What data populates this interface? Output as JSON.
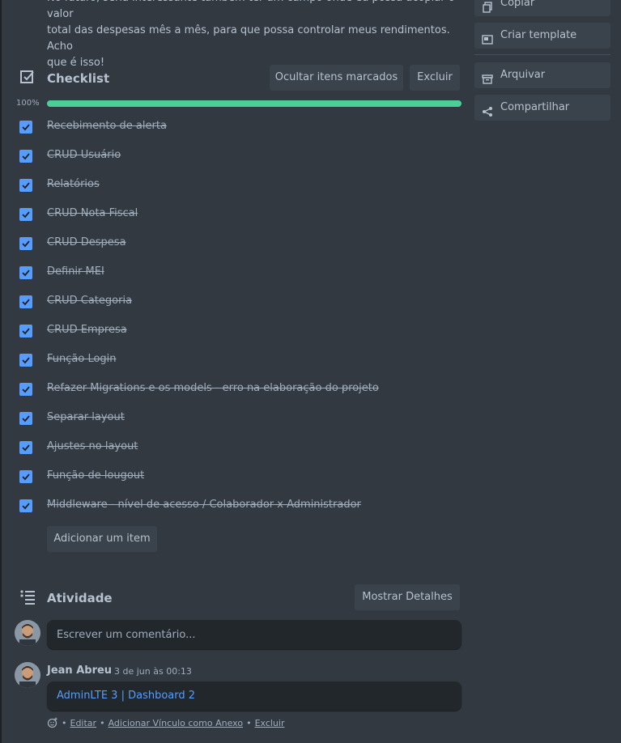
{
  "description": {
    "line1": "No futuro, seria interessante também ter um campo onde eu possa acoplar o valor",
    "line2": "total das despesas mês a mês, para que possa controlar meus rendimentos. Acho",
    "line3": "que é isso!"
  },
  "checklist": {
    "title": "Checklist",
    "hide_checked_label": "Ocultar itens marcados",
    "delete_label": "Excluir",
    "progress_label": "100%",
    "progress": 1.0,
    "items": [
      {
        "label": "Recebimento de alerta",
        "checked": true
      },
      {
        "label": "CRUD Usuário",
        "checked": true
      },
      {
        "label": "Relatórios",
        "checked": true
      },
      {
        "label": "CRUD Nota Fiscal",
        "checked": true
      },
      {
        "label": "CRUD Despesa",
        "checked": true
      },
      {
        "label": "Definir MEI",
        "checked": true
      },
      {
        "label": "CRUD Categoria",
        "checked": true
      },
      {
        "label": "CRUD Empresa",
        "checked": true
      },
      {
        "label": "Função Login",
        "checked": true
      },
      {
        "label": "Refazer Migrations e os models - erro na elaboração do projeto",
        "checked": true
      },
      {
        "label": "Separar layout",
        "checked": true
      },
      {
        "label": "Ajustes no layout",
        "checked": true
      },
      {
        "label": "Função de lougout",
        "checked": true
      },
      {
        "label": "Middleware - nível de acesso / Colaborador x Administrador",
        "checked": true
      }
    ],
    "add_item_label": "Adicionar um item"
  },
  "activity": {
    "title": "Atividade",
    "show_details_label": "Mostrar Detalhes",
    "comment_placeholder": "Escrever um comentário...",
    "comment": {
      "author": "Jean Abreu",
      "timestamp": "3 de jun às 00:13",
      "text": "AdminLTE 3 | Dashboard 2",
      "actions": {
        "edit": "Editar",
        "add_attachment": "Adicionar Vínculo como Anexo",
        "delete": "Excluir",
        "separator": "•"
      }
    }
  },
  "sidebar": {
    "copy": "Copiar",
    "create_template": "Criar template",
    "archive": "Arquivar",
    "share": "Compartilhar"
  },
  "colors": {
    "background": "#323940",
    "button": "#3a424b",
    "progress": "#4bce97",
    "checkbox": "#579dff",
    "link": "#579dff",
    "text": "#b6c2cf"
  }
}
